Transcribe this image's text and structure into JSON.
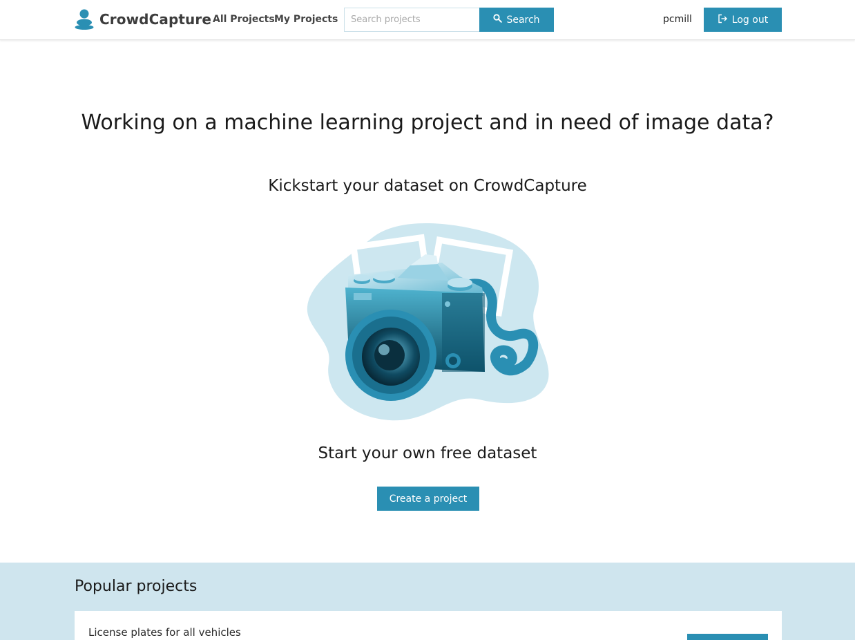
{
  "brand": {
    "name": "CrowdCapture",
    "logo_icon": "person-icon"
  },
  "nav": {
    "all_projects": "All Projects",
    "my_projects": "My Projects"
  },
  "search": {
    "placeholder": "Search projects",
    "value": "",
    "button_label": "Search",
    "button_icon": "search-icon"
  },
  "user": {
    "username": "pcmill",
    "logout_label": "Log out",
    "logout_icon": "logout-icon"
  },
  "hero": {
    "title": "Working on a machine learning project and in need of image data?",
    "subtitle": "Kickstart your dataset on CrowdCapture",
    "illustration": "camera-illustration",
    "cta_text": "Start your own free dataset",
    "cta_button": "Create a project"
  },
  "popular": {
    "title": "Popular projects",
    "projects": [
      {
        "name": "License plates for all vehicles"
      }
    ]
  },
  "colors": {
    "accent": "#2a8fb3",
    "section_bg": "#cfe5ee",
    "illustration_bg": "#cde7f0"
  }
}
